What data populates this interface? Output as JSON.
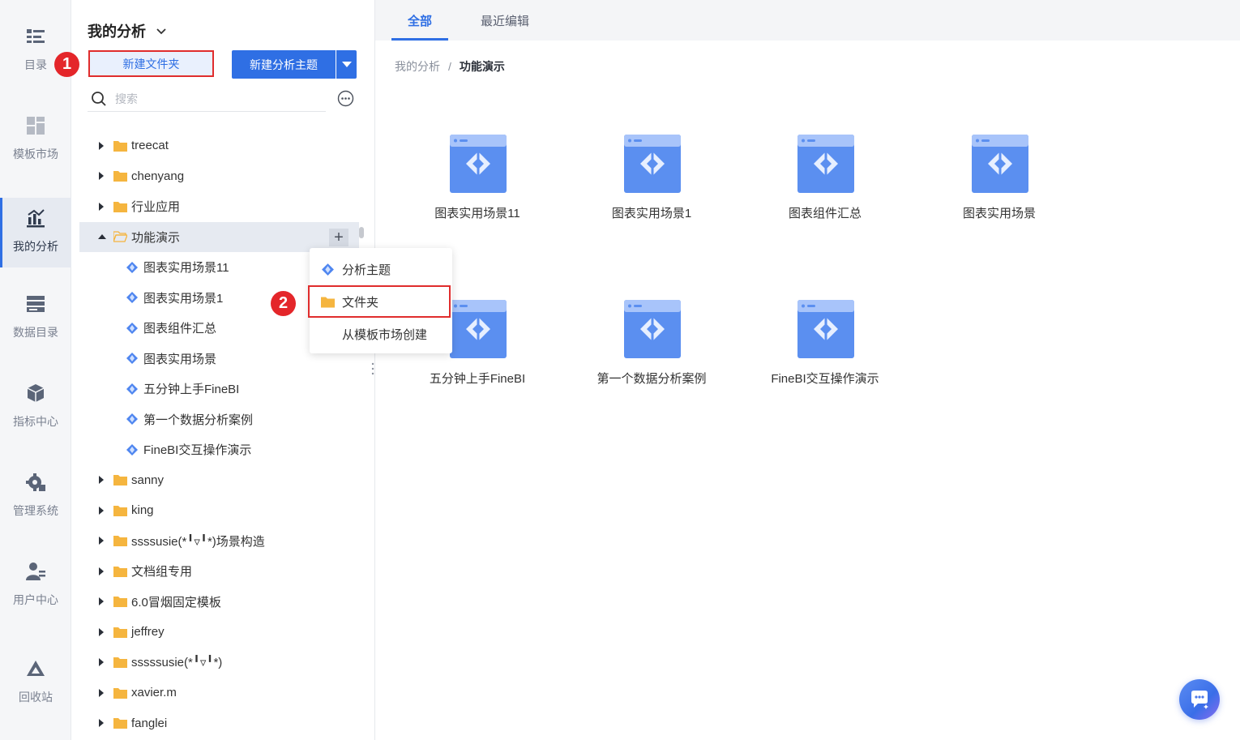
{
  "nav": {
    "items": [
      {
        "label": "目录",
        "icon": "catalog-icon"
      },
      {
        "label": "模板市场",
        "icon": "template-market-icon"
      },
      {
        "label": "我的分析",
        "icon": "my-analysis-icon",
        "active": true
      },
      {
        "label": "数据目录",
        "icon": "data-catalog-icon"
      },
      {
        "label": "指标中心",
        "icon": "metric-center-icon"
      },
      {
        "label": "管理系统",
        "icon": "management-icon"
      },
      {
        "label": "用户中心",
        "icon": "user-center-icon"
      },
      {
        "label": "回收站",
        "icon": "recycle-bin-icon"
      }
    ]
  },
  "panel": {
    "title": "我的分析",
    "new_folder_label": "新建文件夹",
    "new_theme_label": "新建分析主题",
    "search_placeholder": "搜索",
    "steps": [
      "1",
      "2"
    ]
  },
  "tree": {
    "folders_before": [
      "treecat",
      "chenyang",
      "行业应用"
    ],
    "expanded_folder": "功能演示",
    "children": [
      "图表实用场景11",
      "图表实用场景1",
      "图表组件汇总",
      "图表实用场景",
      "五分钟上手FineBI",
      "第一个数据分析案例",
      "FineBI交互操作演示"
    ],
    "folders_after": [
      "sanny",
      "king",
      "ssssusie(*╹▿╹*)场景构造",
      "文档组专用",
      "6.0冒烟固定模板",
      "jeffrey",
      "sssssusie(*╹▿╹*)",
      "xavier.m",
      "fanglei"
    ]
  },
  "popup": {
    "items": [
      {
        "label": "分析主题",
        "icon": "analysis-theme-icon"
      },
      {
        "label": "文件夹",
        "icon": "folder-icon"
      },
      {
        "label": "从模板市场创建",
        "icon": ""
      }
    ]
  },
  "main": {
    "tabs": [
      "全部",
      "最近编辑"
    ],
    "breadcrumb_root": "我的分析",
    "breadcrumb_sep": "/",
    "breadcrumb_current": "功能演示",
    "cards": [
      "图表实用场景11",
      "图表实用场景1",
      "图表组件汇总",
      "图表实用场景",
      "五分钟上手FineBI",
      "第一个数据分析案例",
      "FineBI交互操作演示"
    ]
  },
  "colors": {
    "accent": "#2f6fe4",
    "highlight_box": "#e02d2d",
    "step_badge": "#e4262a",
    "folder": "#f5b53f",
    "card_icon": "#5b8ff0"
  }
}
